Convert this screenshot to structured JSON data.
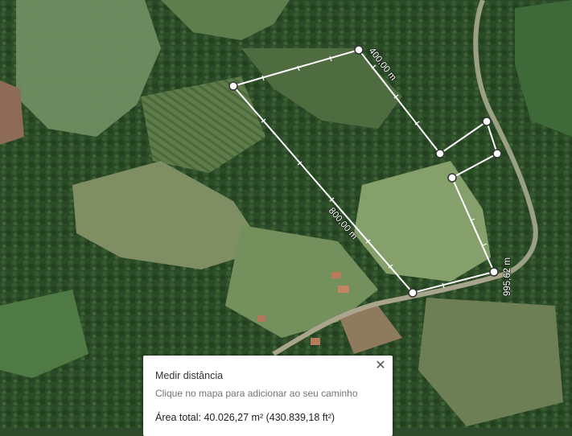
{
  "map": {
    "type": "satellite",
    "segment_labels": [
      "400,00 m",
      "800,00 m",
      "995,62 m"
    ]
  },
  "panel": {
    "title": "Medir distância",
    "hint": "Clique no mapa para adicionar ao seu caminho",
    "area_total": "Área total: 40.026,27 m² (430.839,18 ft²)",
    "close_icon": "close-icon"
  },
  "colors": {
    "measure_line": "#ffffff",
    "panel_bg": "#ffffff"
  }
}
